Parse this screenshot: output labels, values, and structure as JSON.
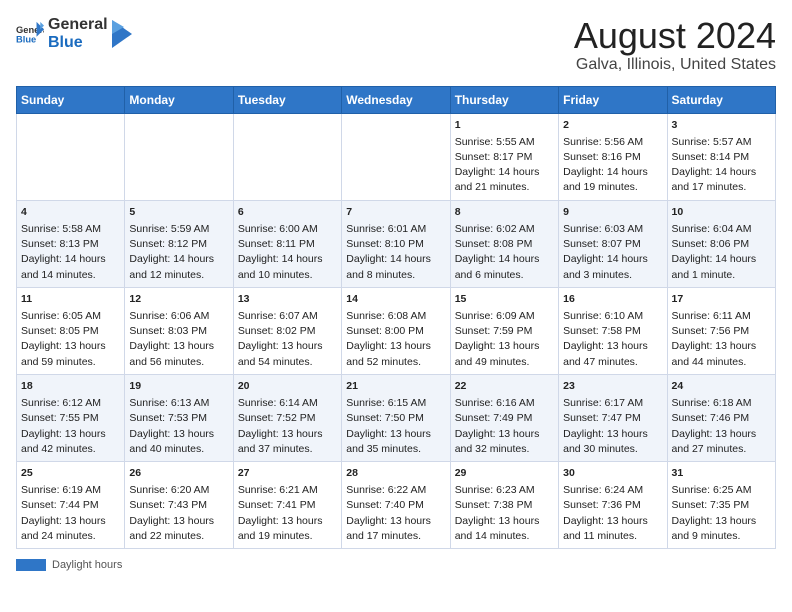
{
  "header": {
    "logo": {
      "general": "General",
      "blue": "Blue"
    },
    "title": "August 2024",
    "subtitle": "Galva, Illinois, United States"
  },
  "days_of_week": [
    "Sunday",
    "Monday",
    "Tuesday",
    "Wednesday",
    "Thursday",
    "Friday",
    "Saturday"
  ],
  "weeks": [
    [
      {
        "day": "",
        "content": ""
      },
      {
        "day": "",
        "content": ""
      },
      {
        "day": "",
        "content": ""
      },
      {
        "day": "",
        "content": ""
      },
      {
        "day": "1",
        "content": "Sunrise: 5:55 AM\nSunset: 8:17 PM\nDaylight: 14 hours\nand 21 minutes."
      },
      {
        "day": "2",
        "content": "Sunrise: 5:56 AM\nSunset: 8:16 PM\nDaylight: 14 hours\nand 19 minutes."
      },
      {
        "day": "3",
        "content": "Sunrise: 5:57 AM\nSunset: 8:14 PM\nDaylight: 14 hours\nand 17 minutes."
      }
    ],
    [
      {
        "day": "4",
        "content": "Sunrise: 5:58 AM\nSunset: 8:13 PM\nDaylight: 14 hours\nand 14 minutes."
      },
      {
        "day": "5",
        "content": "Sunrise: 5:59 AM\nSunset: 8:12 PM\nDaylight: 14 hours\nand 12 minutes."
      },
      {
        "day": "6",
        "content": "Sunrise: 6:00 AM\nSunset: 8:11 PM\nDaylight: 14 hours\nand 10 minutes."
      },
      {
        "day": "7",
        "content": "Sunrise: 6:01 AM\nSunset: 8:10 PM\nDaylight: 14 hours\nand 8 minutes."
      },
      {
        "day": "8",
        "content": "Sunrise: 6:02 AM\nSunset: 8:08 PM\nDaylight: 14 hours\nand 6 minutes."
      },
      {
        "day": "9",
        "content": "Sunrise: 6:03 AM\nSunset: 8:07 PM\nDaylight: 14 hours\nand 3 minutes."
      },
      {
        "day": "10",
        "content": "Sunrise: 6:04 AM\nSunset: 8:06 PM\nDaylight: 14 hours\nand 1 minute."
      }
    ],
    [
      {
        "day": "11",
        "content": "Sunrise: 6:05 AM\nSunset: 8:05 PM\nDaylight: 13 hours\nand 59 minutes."
      },
      {
        "day": "12",
        "content": "Sunrise: 6:06 AM\nSunset: 8:03 PM\nDaylight: 13 hours\nand 56 minutes."
      },
      {
        "day": "13",
        "content": "Sunrise: 6:07 AM\nSunset: 8:02 PM\nDaylight: 13 hours\nand 54 minutes."
      },
      {
        "day": "14",
        "content": "Sunrise: 6:08 AM\nSunset: 8:00 PM\nDaylight: 13 hours\nand 52 minutes."
      },
      {
        "day": "15",
        "content": "Sunrise: 6:09 AM\nSunset: 7:59 PM\nDaylight: 13 hours\nand 49 minutes."
      },
      {
        "day": "16",
        "content": "Sunrise: 6:10 AM\nSunset: 7:58 PM\nDaylight: 13 hours\nand 47 minutes."
      },
      {
        "day": "17",
        "content": "Sunrise: 6:11 AM\nSunset: 7:56 PM\nDaylight: 13 hours\nand 44 minutes."
      }
    ],
    [
      {
        "day": "18",
        "content": "Sunrise: 6:12 AM\nSunset: 7:55 PM\nDaylight: 13 hours\nand 42 minutes."
      },
      {
        "day": "19",
        "content": "Sunrise: 6:13 AM\nSunset: 7:53 PM\nDaylight: 13 hours\nand 40 minutes."
      },
      {
        "day": "20",
        "content": "Sunrise: 6:14 AM\nSunset: 7:52 PM\nDaylight: 13 hours\nand 37 minutes."
      },
      {
        "day": "21",
        "content": "Sunrise: 6:15 AM\nSunset: 7:50 PM\nDaylight: 13 hours\nand 35 minutes."
      },
      {
        "day": "22",
        "content": "Sunrise: 6:16 AM\nSunset: 7:49 PM\nDaylight: 13 hours\nand 32 minutes."
      },
      {
        "day": "23",
        "content": "Sunrise: 6:17 AM\nSunset: 7:47 PM\nDaylight: 13 hours\nand 30 minutes."
      },
      {
        "day": "24",
        "content": "Sunrise: 6:18 AM\nSunset: 7:46 PM\nDaylight: 13 hours\nand 27 minutes."
      }
    ],
    [
      {
        "day": "25",
        "content": "Sunrise: 6:19 AM\nSunset: 7:44 PM\nDaylight: 13 hours\nand 24 minutes."
      },
      {
        "day": "26",
        "content": "Sunrise: 6:20 AM\nSunset: 7:43 PM\nDaylight: 13 hours\nand 22 minutes."
      },
      {
        "day": "27",
        "content": "Sunrise: 6:21 AM\nSunset: 7:41 PM\nDaylight: 13 hours\nand 19 minutes."
      },
      {
        "day": "28",
        "content": "Sunrise: 6:22 AM\nSunset: 7:40 PM\nDaylight: 13 hours\nand 17 minutes."
      },
      {
        "day": "29",
        "content": "Sunrise: 6:23 AM\nSunset: 7:38 PM\nDaylight: 13 hours\nand 14 minutes."
      },
      {
        "day": "30",
        "content": "Sunrise: 6:24 AM\nSunset: 7:36 PM\nDaylight: 13 hours\nand 11 minutes."
      },
      {
        "day": "31",
        "content": "Sunrise: 6:25 AM\nSunset: 7:35 PM\nDaylight: 13 hours\nand 9 minutes."
      }
    ]
  ],
  "footer": {
    "label": "Daylight hours"
  },
  "colors": {
    "header_bg": "#2f76c7",
    "row_even": "#f0f4fa",
    "row_odd": "#ffffff"
  }
}
